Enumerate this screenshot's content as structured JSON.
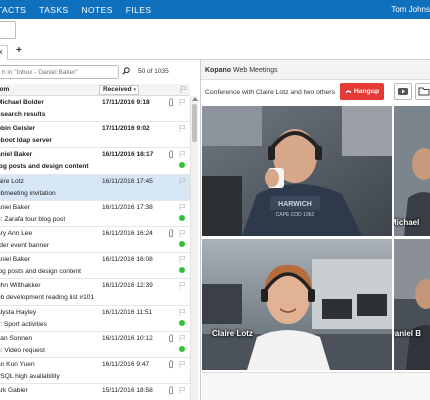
{
  "topnav": {
    "items": [
      "TACTS",
      "TASKS",
      "NOTES",
      "FILES"
    ],
    "user": "Tom Johns"
  },
  "tabs": {
    "inbox_label": "x",
    "add_label": "+"
  },
  "list": {
    "search_placeholder": "h in \"Inbox - Daniel Baker\"",
    "page_count": "50 of 1035",
    "col_from": "rom",
    "col_received": "Received",
    "sort_arrow": "▾",
    "rows": [
      {
        "from": "Michael Bolder",
        "subject": "esearch results",
        "date": "17/11/2016 9:18",
        "unread": true,
        "selected": false,
        "attach": true,
        "dot": false
      },
      {
        "from": "obin Geisler",
        "subject": "eboot ldap server",
        "date": "17/11/2016 9:02",
        "unread": true,
        "selected": false,
        "attach": false,
        "dot": false
      },
      {
        "from": "aniel Baker",
        "subject": "log posts and design content",
        "date": "16/11/2016 18:17",
        "unread": true,
        "selected": false,
        "attach": true,
        "dot": true
      },
      {
        "from": "laire Lotz",
        "subject": "ebmeeting invitation",
        "date": "16/11/2016 17:45",
        "unread": false,
        "selected": true,
        "attach": false,
        "dot": false
      },
      {
        "from": "aniel Baker",
        "subject": "e: Zarafa tour blog post",
        "date": "16/11/2016 17:38",
        "unread": false,
        "selected": false,
        "attach": false,
        "dot": true
      },
      {
        "from": "ary Ann Lee",
        "subject": "rder event banner",
        "date": "16/11/2016 16:24",
        "unread": false,
        "selected": false,
        "attach": true,
        "dot": true
      },
      {
        "from": "aniel Baker",
        "subject": "log posts and design content",
        "date": "16/11/2016 16:08",
        "unread": false,
        "selected": false,
        "attach": false,
        "dot": true
      },
      {
        "from": "ohn Wilthakker",
        "subject": "eb development reading list #101",
        "date": "16/11/2016 12:39",
        "unread": false,
        "selected": false,
        "attach": false,
        "dot": false
      },
      {
        "from": "alysta Hayley",
        "subject": "v: Sport activities",
        "date": "16/11/2016 11:51",
        "unread": false,
        "selected": false,
        "attach": false,
        "dot": true
      },
      {
        "from": "yan Sonnen",
        "subject": "e: Video request",
        "date": "16/11/2016 10:12",
        "unread": false,
        "selected": false,
        "attach": true,
        "dot": true
      },
      {
        "from": "an Kun Yuen",
        "subject": "ySQL high availability",
        "date": "16/11/2016 9:47",
        "unread": false,
        "selected": false,
        "attach": true,
        "dot": false
      },
      {
        "from": "ark Gabler",
        "subject": "",
        "date": "15/11/2016 18:58",
        "unread": false,
        "selected": false,
        "attach": true,
        "dot": false
      }
    ]
  },
  "meeting": {
    "app_brand": "Kopano",
    "app_name": " Web Meetings",
    "conference_title": "Conference with Claire Lotz and two others",
    "hangup_label": "Hangup",
    "participants": [
      "Michael",
      "Claire Lotz",
      "Daniel B"
    ]
  },
  "colors": {
    "topbar": "#0f70bd",
    "hangup": "#e53935",
    "unread_dot": "#2fbf3a",
    "selected_row": "#d6e6f5"
  }
}
